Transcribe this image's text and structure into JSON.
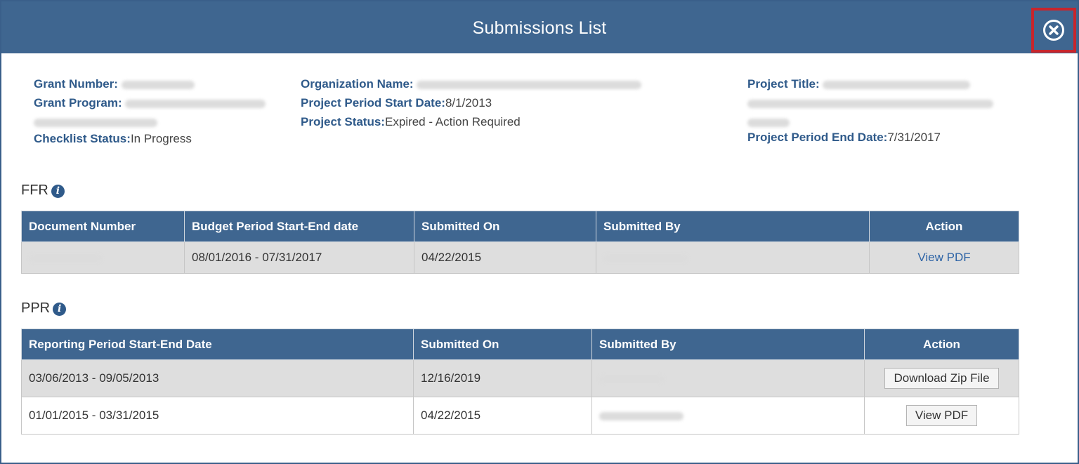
{
  "header": {
    "title": "Submissions List"
  },
  "details": {
    "grant_number_label": "Grant Number:",
    "grant_program_label": "Grant Program:",
    "checklist_status_label": "Checklist Status:",
    "checklist_status_value": "In Progress",
    "organization_name_label": "Organization Name:",
    "project_period_start_label": "Project Period Start Date:",
    "project_period_start_value": "8/1/2013",
    "project_status_label": "Project Status:",
    "project_status_value": "Expired - Action Required",
    "project_title_label": "Project Title:",
    "project_period_end_label": "Project Period End Date:",
    "project_period_end_value": "7/31/2017"
  },
  "ffr": {
    "title": "FFR",
    "columns": [
      "Document Number",
      "Budget Period Start-End date",
      "Submitted On",
      "Submitted By",
      "Action"
    ],
    "rows": [
      {
        "budget_period": "08/01/2016 - 07/31/2017",
        "submitted_on": "04/22/2015",
        "action": "View PDF"
      }
    ]
  },
  "ppr": {
    "title": "PPR",
    "columns": [
      "Reporting Period Start-End Date",
      "Submitted On",
      "Submitted By",
      "Action"
    ],
    "rows": [
      {
        "reporting_period": "03/06/2013 - 09/05/2013",
        "submitted_on": "12/16/2019",
        "action": "Download Zip File"
      },
      {
        "reporting_period": "01/01/2015 - 03/31/2015",
        "submitted_on": "04/22/2015",
        "action": "View PDF"
      }
    ]
  },
  "icons": {
    "close": "close-circle-icon",
    "info": "info-icon"
  },
  "colors": {
    "header": "#3f6690",
    "label": "#2f5a8a",
    "link": "#2e64a6",
    "highlight": "#c8252c"
  }
}
